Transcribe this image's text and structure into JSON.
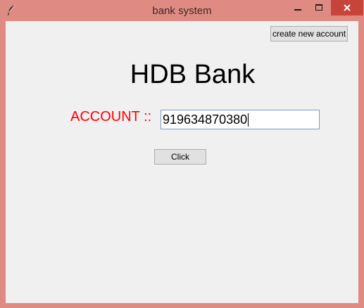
{
  "window": {
    "title": "bank system",
    "icon": "feather-icon",
    "controls": {
      "minimize_icon": "minimize-icon",
      "maximize_icon": "maximize-icon",
      "close_icon": "close-icon"
    },
    "colors": {
      "frame": "#df8b83",
      "close_button": "#c7443a",
      "client_background": "#f0f0f0"
    }
  },
  "toolbar": {
    "new_account_label": "create new account"
  },
  "main": {
    "bank_title": "HDB Bank",
    "account_label": "ACCOUNT ::",
    "account_value": "919634870380",
    "account_label_color": "#ff0000",
    "click_label": "Click"
  }
}
